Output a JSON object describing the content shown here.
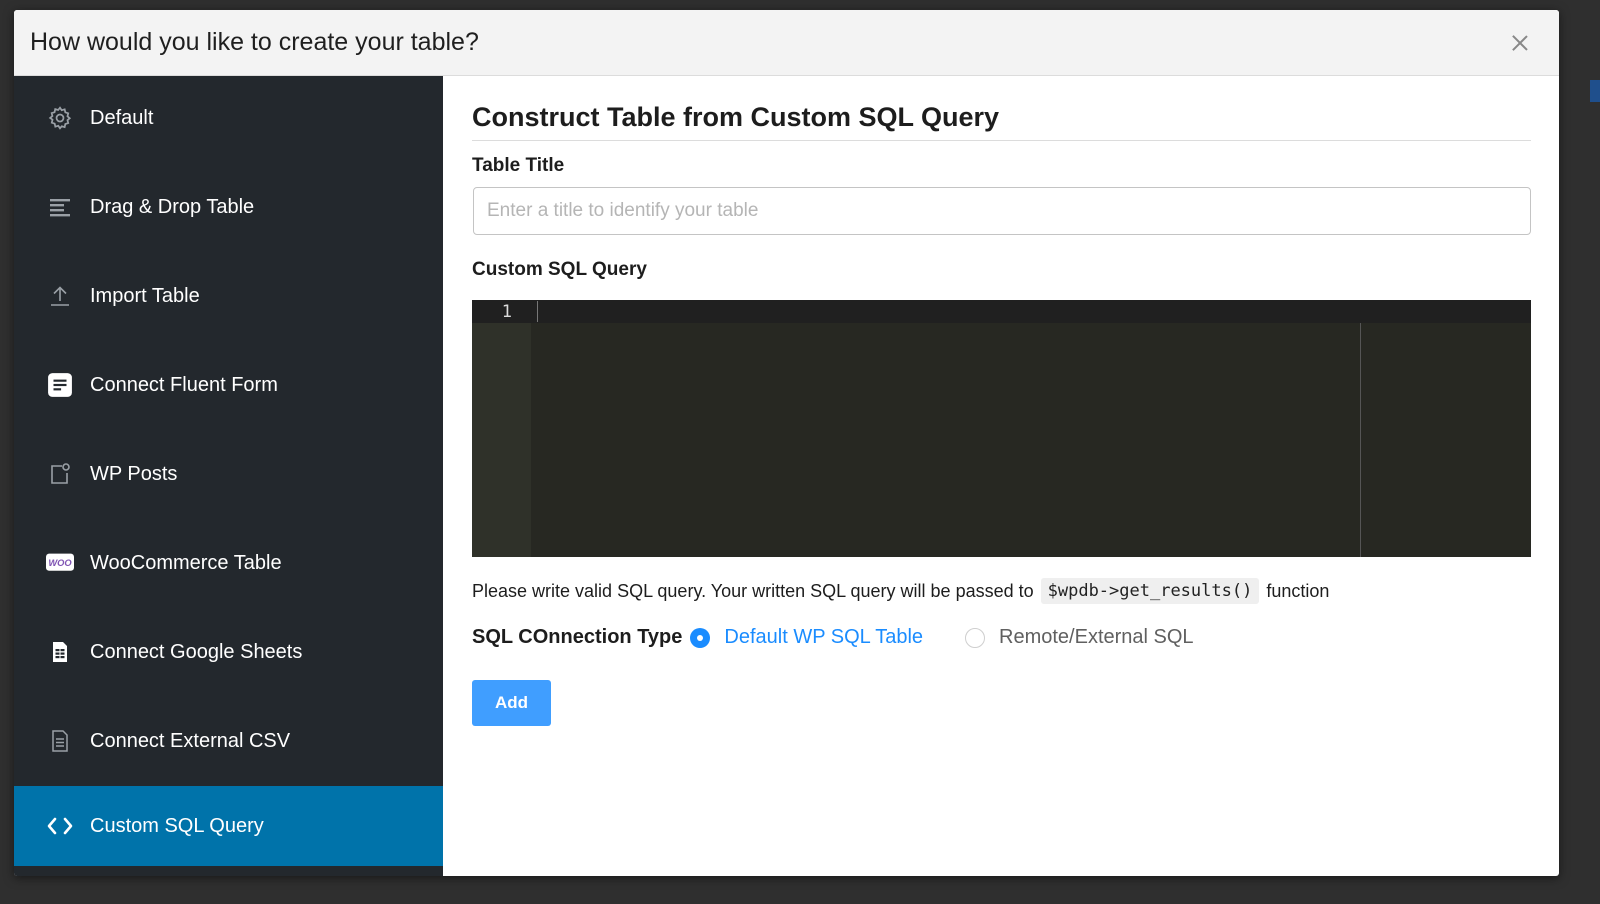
{
  "modal": {
    "title": "How would you like to create your table?"
  },
  "sidebar": {
    "items": [
      {
        "label": "Default",
        "icon": "gear-icon"
      },
      {
        "label": "Drag & Drop Table",
        "icon": "drag-lines-icon"
      },
      {
        "label": "Import Table",
        "icon": "upload-icon"
      },
      {
        "label": "Connect Fluent Form",
        "icon": "fluent-form-icon"
      },
      {
        "label": "WP Posts",
        "icon": "post-icon"
      },
      {
        "label": "WooCommerce Table",
        "icon": "woo-icon",
        "icon_text": "WOO"
      },
      {
        "label": "Connect Google Sheets",
        "icon": "spreadsheet-icon"
      },
      {
        "label": "Connect External CSV",
        "icon": "document-icon"
      },
      {
        "label": "Custom SQL Query",
        "icon": "code-icon",
        "active": true
      }
    ]
  },
  "main": {
    "heading": "Construct Table from Custom SQL Query",
    "title_label": "Table Title",
    "title_placeholder": "Enter a title to identify your table",
    "title_value": "",
    "query_label": "Custom SQL Query",
    "editor": {
      "line_number": "1",
      "content": ""
    },
    "help": {
      "text_before": "Please write valid SQL query. Your written SQL query will be passed to",
      "code": "$wpdb->get_results()",
      "text_after": "function"
    },
    "connection": {
      "label": "SQL COnnection Type",
      "options": [
        {
          "label": "Default WP SQL Table",
          "checked": true
        },
        {
          "label": "Remote/External SQL",
          "checked": false
        }
      ]
    },
    "add_button": "Add"
  },
  "colors": {
    "sidebar_bg": "#23282d",
    "sidebar_active": "#0073aa",
    "accent": "#1a8cff",
    "button": "#409eff",
    "editor_bg": "#272822"
  }
}
